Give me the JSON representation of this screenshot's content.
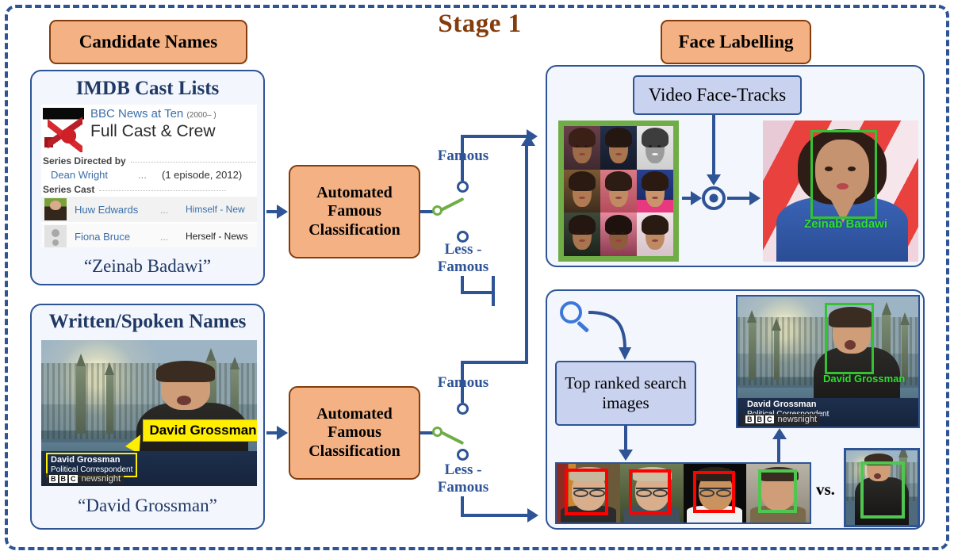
{
  "stage": {
    "title": "Stage 1"
  },
  "headers": {
    "candidate_names": "Candidate Names",
    "face_labelling": "Face Labelling"
  },
  "panels": {
    "imdb": {
      "title": "IMDB Cast Lists",
      "show_title": "BBC News at Ten",
      "show_years": "(2000– )",
      "subtitle": "Full Cast & Crew",
      "section_directed": "Series Directed by",
      "section_cast": "Series Cast",
      "director_name": "Dean Wright",
      "director_dots": "...",
      "director_episode": "(1 episode, 2012)",
      "cast": [
        {
          "name": "Huw Edwards",
          "dots": "...",
          "role": "Himself - New"
        },
        {
          "name": "Fiona Bruce",
          "dots": "...",
          "role": "Herself - News"
        }
      ],
      "quote": "“Zeinab Badawi”"
    },
    "written": {
      "title": "Written/Spoken Names",
      "callout": "David Grossman",
      "chyron_name": "David Grossman",
      "chyron_role": "Political Correspondent",
      "chyron_logo_b1": "B",
      "chyron_logo_b2": "B",
      "chyron_logo_b3": "C",
      "chyron_logo_word": "newsnight",
      "quote": "“David Grossman”"
    },
    "faces": {
      "box_label": "Video Face-Tracks",
      "result_label": "Zeinab Badawi"
    },
    "search": {
      "box_label": "Top ranked search images",
      "vs_label": "vs.",
      "result_label": "David Grossman",
      "chyron_name": "David Grossman",
      "chyron_role": "Political Correspondent",
      "chyron_logo_b1": "B",
      "chyron_logo_b2": "B",
      "chyron_logo_b3": "C",
      "chyron_logo_word": "newsnight"
    }
  },
  "processes": {
    "top": {
      "line1": "Automated",
      "line2": "Famous",
      "line3": "Classification"
    },
    "bottom": {
      "line1": "Automated",
      "line2": "Famous",
      "line3": "Classification"
    }
  },
  "switches": {
    "top": {
      "famous": "Famous",
      "less_famous_line1": "Less -",
      "less_famous_line2": "Famous",
      "position": "famous"
    },
    "bottom": {
      "famous": "Famous",
      "less_famous_line1": "Less -",
      "less_famous_line2": "Famous",
      "position": "less-famous"
    }
  },
  "colors": {
    "navy": "#2E5496",
    "orange_fill": "#F4B183",
    "orange_border": "#843C0C",
    "panel_fill": "#F3F6FC",
    "blue_box_fill": "#C9D2EE",
    "green": "#70AD47",
    "red_box": "#FF0000",
    "green_box": "#4FC64F",
    "title_brown": "#843C0C",
    "panel_title_navy": "#1F3864"
  },
  "search_results": [
    {
      "box": "red"
    },
    {
      "box": "red"
    },
    {
      "box": "red"
    },
    {
      "box": "green"
    }
  ]
}
